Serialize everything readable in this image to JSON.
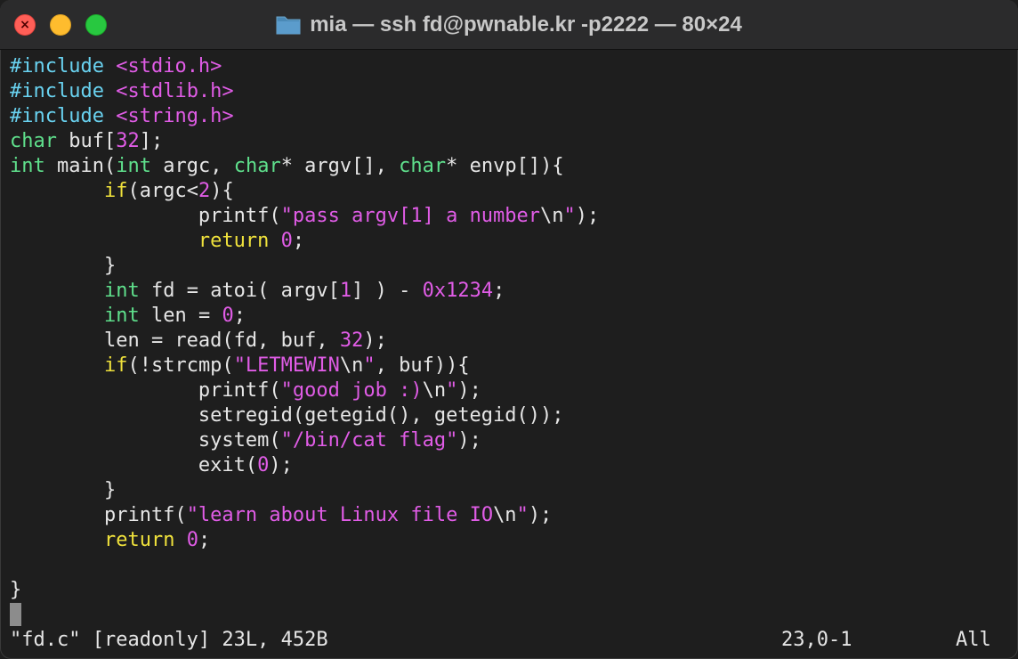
{
  "window": {
    "title": "mia — ssh fd@pwnable.kr -p2222 — 80×24",
    "icon": "folder-icon",
    "buttons": [
      "close-button",
      "minimize-button",
      "maximize-button"
    ]
  },
  "colors": {
    "preprocessor": "#69d2f0",
    "string_and_number": "#e05ce6",
    "type": "#5fe08c",
    "keyword": "#f0e23c",
    "text": "#e6e6e6",
    "background": "#1e1e1e"
  },
  "code_lines": [
    [
      {
        "t": "#include ",
        "c": "cyan"
      },
      {
        "t": "<stdio.h>",
        "c": "magenta"
      }
    ],
    [
      {
        "t": "#include ",
        "c": "cyan"
      },
      {
        "t": "<stdlib.h>",
        "c": "magenta"
      }
    ],
    [
      {
        "t": "#include ",
        "c": "cyan"
      },
      {
        "t": "<string.h>",
        "c": "magenta"
      }
    ],
    [
      {
        "t": "char",
        "c": "green"
      },
      {
        "t": " buf["
      },
      {
        "t": "32",
        "c": "magenta"
      },
      {
        "t": "];"
      }
    ],
    [
      {
        "t": "int",
        "c": "green"
      },
      {
        "t": " main("
      },
      {
        "t": "int",
        "c": "green"
      },
      {
        "t": " argc, "
      },
      {
        "t": "char",
        "c": "green"
      },
      {
        "t": "* argv[], "
      },
      {
        "t": "char",
        "c": "green"
      },
      {
        "t": "* envp[]){"
      }
    ],
    [
      {
        "t": "        "
      },
      {
        "t": "if",
        "c": "yellow"
      },
      {
        "t": "(argc<"
      },
      {
        "t": "2",
        "c": "magenta"
      },
      {
        "t": "){"
      }
    ],
    [
      {
        "t": "                printf("
      },
      {
        "t": "\"pass argv[1] a number",
        "c": "magenta"
      },
      {
        "t": "\\n"
      },
      {
        "t": "\"",
        "c": "magenta"
      },
      {
        "t": ");"
      }
    ],
    [
      {
        "t": "                "
      },
      {
        "t": "return",
        "c": "yellow"
      },
      {
        "t": " "
      },
      {
        "t": "0",
        "c": "magenta"
      },
      {
        "t": ";"
      }
    ],
    [
      {
        "t": "        }"
      }
    ],
    [
      {
        "t": "        "
      },
      {
        "t": "int",
        "c": "green"
      },
      {
        "t": " fd = atoi( argv["
      },
      {
        "t": "1",
        "c": "magenta"
      },
      {
        "t": "] ) - "
      },
      {
        "t": "0x1234",
        "c": "magenta"
      },
      {
        "t": ";"
      }
    ],
    [
      {
        "t": "        "
      },
      {
        "t": "int",
        "c": "green"
      },
      {
        "t": " len = "
      },
      {
        "t": "0",
        "c": "magenta"
      },
      {
        "t": ";"
      }
    ],
    [
      {
        "t": "        len = read(fd, buf, "
      },
      {
        "t": "32",
        "c": "magenta"
      },
      {
        "t": ");"
      }
    ],
    [
      {
        "t": "        "
      },
      {
        "t": "if",
        "c": "yellow"
      },
      {
        "t": "(!strcmp("
      },
      {
        "t": "\"LETMEWIN",
        "c": "magenta"
      },
      {
        "t": "\\n"
      },
      {
        "t": "\"",
        "c": "magenta"
      },
      {
        "t": ", buf)){"
      }
    ],
    [
      {
        "t": "                printf("
      },
      {
        "t": "\"good job :)",
        "c": "magenta"
      },
      {
        "t": "\\n"
      },
      {
        "t": "\"",
        "c": "magenta"
      },
      {
        "t": ");"
      }
    ],
    [
      {
        "t": "                setregid(getegid(), getegid());"
      }
    ],
    [
      {
        "t": "                system("
      },
      {
        "t": "\"/bin/cat flag\"",
        "c": "magenta"
      },
      {
        "t": ");"
      }
    ],
    [
      {
        "t": "                exit("
      },
      {
        "t": "0",
        "c": "magenta"
      },
      {
        "t": ");"
      }
    ],
    [
      {
        "t": "        }"
      }
    ],
    [
      {
        "t": "        printf("
      },
      {
        "t": "\"learn about Linux file IO",
        "c": "magenta"
      },
      {
        "t": "\\n"
      },
      {
        "t": "\"",
        "c": "magenta"
      },
      {
        "t": ");"
      }
    ],
    [
      {
        "t": "        "
      },
      {
        "t": "return",
        "c": "yellow"
      },
      {
        "t": " "
      },
      {
        "t": "0",
        "c": "magenta"
      },
      {
        "t": ";"
      }
    ],
    [],
    [
      {
        "t": "}"
      }
    ]
  ],
  "status": {
    "file_info": "\"fd.c\" [readonly] 23L, 452B",
    "position": "23,0-1",
    "scroll": "All"
  }
}
